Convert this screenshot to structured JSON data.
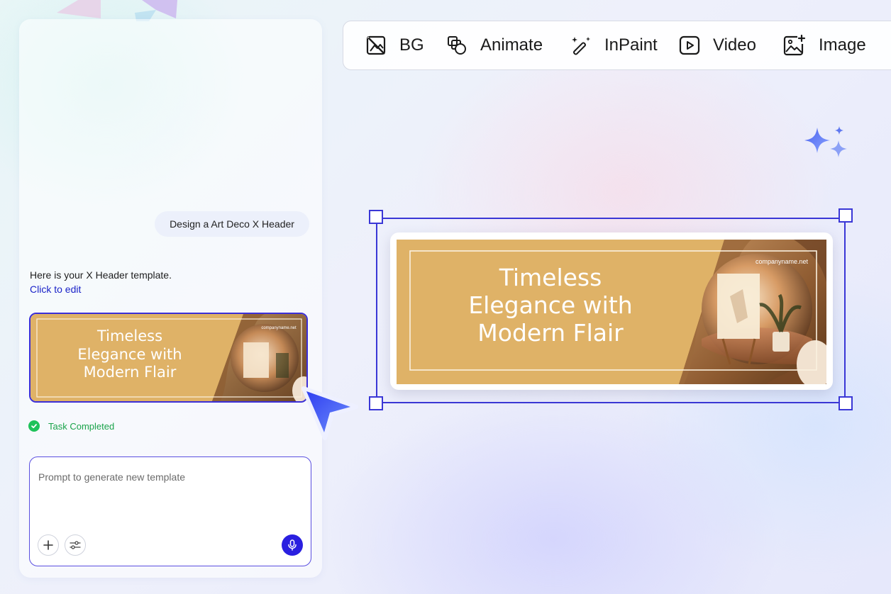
{
  "toolbar": {
    "items": [
      {
        "label": "BG",
        "icon": "bg-remove-icon"
      },
      {
        "label": "Animate",
        "icon": "animate-icon"
      },
      {
        "label": "InPaint",
        "icon": "magic-wand-icon"
      },
      {
        "label": "Video",
        "icon": "video-play-icon"
      },
      {
        "label": "Image",
        "icon": "image-add-icon"
      }
    ]
  },
  "chat": {
    "user_message": "Design a Art Deco X Header",
    "assistant_message": "Here is your X Header template.",
    "edit_link": "Click to edit",
    "status": "Task Completed"
  },
  "template": {
    "headline_line1": "Timeless",
    "headline_line2": "Elegance with",
    "headline_line3": "Modern Flair",
    "website": "companyname.net"
  },
  "prompt": {
    "placeholder": "Prompt to generate new template"
  },
  "colors": {
    "accent": "#3a37d6",
    "mustard": "#dfb267",
    "success": "#1ec25a"
  }
}
